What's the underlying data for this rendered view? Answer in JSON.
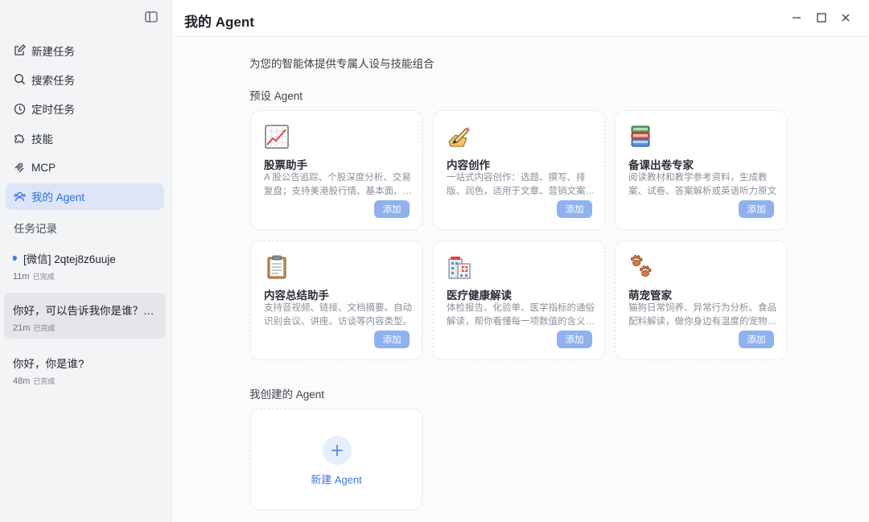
{
  "sidebar": {
    "nav": [
      {
        "label": "新建任务",
        "icon": "edit-icon"
      },
      {
        "label": "搜索任务",
        "icon": "search-icon"
      },
      {
        "label": "定时任务",
        "icon": "clock-icon"
      },
      {
        "label": "技能",
        "icon": "puzzle-icon"
      },
      {
        "label": "MCP",
        "icon": "mcp-icon"
      },
      {
        "label": "我的 Agent",
        "icon": "agent-icon",
        "active": true
      }
    ],
    "history_label": "任务记录",
    "tasks": [
      {
        "title": "[微信] 2qtej8z6uuje",
        "time": "11m",
        "status": "已完成",
        "unread": true
      },
      {
        "title": "你好，可以告诉我你是谁？使用中文回答",
        "time": "21m",
        "status": "已完成",
        "selected": true
      },
      {
        "title": "你好，你是谁?",
        "time": "48m",
        "status": "已完成"
      }
    ]
  },
  "header": {
    "title": "我的 Agent"
  },
  "main": {
    "subtitle": "为您的智能体提供专属人设与技能组合",
    "preset_title": "预设 Agent",
    "presets": [
      {
        "name": "股票助手",
        "desc": "A 股公告追踪、个股深度分析、交易复盘；支持美港股行情、基本面、技术面分析",
        "add": "添加",
        "icon": "chart-icon"
      },
      {
        "name": "内容创作",
        "desc": "一站式内容创作：选题、撰写、排版、润色，适用于文章、营销文案等多种场景",
        "add": "添加",
        "icon": "writing-icon"
      },
      {
        "name": "备课出卷专家",
        "desc": "阅读教材和教学参考资料，生成教案、试卷、答案解析或英语听力原文",
        "add": "添加",
        "icon": "books-icon"
      },
      {
        "name": "内容总结助手",
        "desc": "支持音视频、链接、文档摘要。自动识别会议、讲座、访谈等内容类型。",
        "add": "添加",
        "icon": "clipboard-icon"
      },
      {
        "name": "医疗健康解读",
        "desc": "体检报告、化验单、医学指标的通俗解读，帮你看懂每一项数值的含义与建议",
        "add": "添加",
        "icon": "hospital-icon"
      },
      {
        "name": "萌宠管家",
        "desc": "猫狗日常饲养、异常行为分析、食品配料解读，做你身边有温度的宠物顾问",
        "add": "添加",
        "icon": "paw-icon"
      }
    ],
    "created_title": "我创建的 Agent",
    "new_agent_label": "新建 Agent"
  },
  "colors": {
    "accent": "#3a77e0",
    "add_button": "#8fb2ee",
    "active_nav_bg": "#dde6f9"
  }
}
